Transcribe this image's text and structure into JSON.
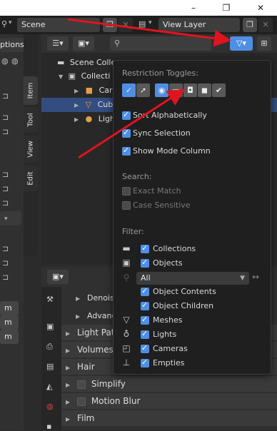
{
  "window": {
    "minimize": "–",
    "maximize": "❐",
    "close": "✕"
  },
  "topbar": {
    "scene_name": "Scene",
    "view_layer": "View Layer",
    "options": "ptions"
  },
  "sidebar_tabs": [
    "Item",
    "Tool",
    "View",
    "Edit"
  ],
  "outliner": {
    "search_placeholder": "",
    "rows": [
      {
        "label": "Scene Colle",
        "indent": 0
      },
      {
        "label": "Collecti",
        "indent": 1
      },
      {
        "label": "Car",
        "indent": 2
      },
      {
        "label": "Cub",
        "indent": 2,
        "selected": true
      },
      {
        "label": "Ligh",
        "indent": 2
      }
    ]
  },
  "popover": {
    "restriction_title": "Restriction Toggles:",
    "sort_alphabetically": "Sort Alphabetically",
    "sync_selection": "Sync Selection",
    "show_mode_column": "Show Mode Column",
    "search_title": "Search:",
    "exact_match": "Exact Match",
    "case_sensitive": "Case Sensitive",
    "filter_title": "Filter:",
    "collections": "Collections",
    "objects": "Objects",
    "objects_mode": "All",
    "object_contents": "Object Contents",
    "object_children": "Object Children",
    "meshes": "Meshes",
    "lights": "Lights",
    "cameras": "Cameras",
    "empties": "Empties"
  },
  "properties": {
    "panels": [
      "Denoisi",
      "Advanc",
      "Light Path",
      "Volumes",
      "Hair",
      "Simplify",
      "Motion Blur",
      "Film"
    ],
    "side_values": [
      "m",
      "m",
      "m"
    ]
  },
  "colors": {
    "accent": "#4f8ee5",
    "arrow": "#e0141e",
    "popover_bg": "#1f1f1f"
  }
}
